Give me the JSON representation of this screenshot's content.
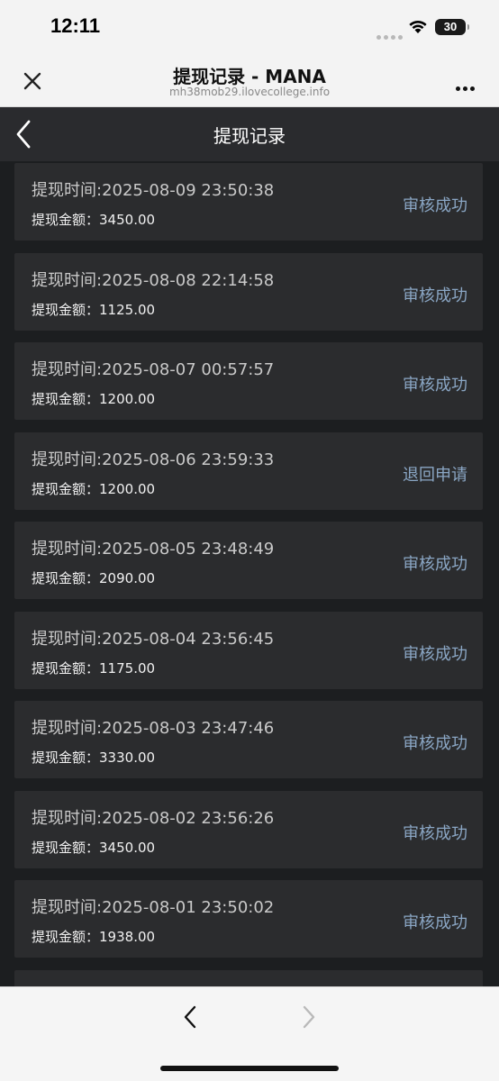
{
  "status_bar": {
    "time": "12:11",
    "battery": "30"
  },
  "browser": {
    "title": "提现记录 - MANA",
    "url": "mh38mob29.ilovecollege.info"
  },
  "header": {
    "title": "提现记录"
  },
  "labels": {
    "time_label": "提现时间:",
    "amount_label": "提现金额："
  },
  "records": [
    {
      "time": "2025-08-09 23:50:38",
      "amount": "3450.00",
      "status": "审核成功"
    },
    {
      "time": "2025-08-08 22:14:58",
      "amount": "1125.00",
      "status": "审核成功"
    },
    {
      "time": "2025-08-07 00:57:57",
      "amount": "1200.00",
      "status": "审核成功"
    },
    {
      "time": "2025-08-06 23:59:33",
      "amount": "1200.00",
      "status": "退回申请"
    },
    {
      "time": "2025-08-05 23:48:49",
      "amount": "2090.00",
      "status": "审核成功"
    },
    {
      "time": "2025-08-04 23:56:45",
      "amount": "1175.00",
      "status": "审核成功"
    },
    {
      "time": "2025-08-03 23:47:46",
      "amount": "3330.00",
      "status": "审核成功"
    },
    {
      "time": "2025-08-02 23:56:26",
      "amount": "3450.00",
      "status": "审核成功"
    },
    {
      "time": "2025-08-01 23:50:02",
      "amount": "1938.00",
      "status": "审核成功"
    }
  ],
  "colors": {
    "background": "#1c1e20",
    "card": "#2b2c2e",
    "status_text": "#8aa6c4",
    "header": "#2a2b2e"
  },
  "icons": {
    "close": "close-icon",
    "more": "more-icon",
    "back": "chevron-left-icon",
    "nav_back": "chevron-left-icon",
    "nav_forward": "chevron-right-icon"
  }
}
